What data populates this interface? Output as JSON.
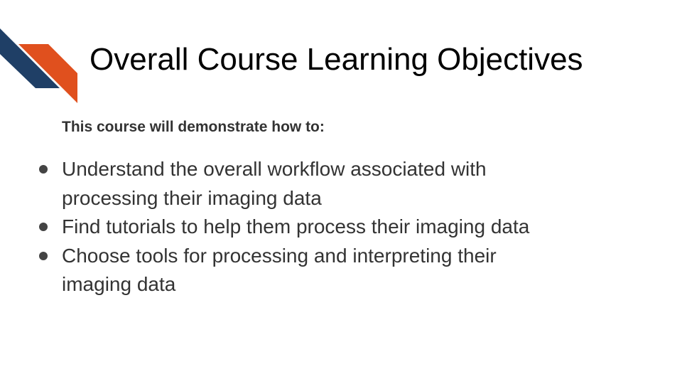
{
  "slide": {
    "title": "Overall Course Learning Objectives",
    "intro": "This course will demonstrate how to:",
    "objectives": [
      {
        "text_line1": "Understand the overall workflow associated with",
        "text_line2": "processing their imaging data"
      },
      {
        "text_line1": "Find tutorials to help them process their imaging data"
      },
      {
        "text_line1": "Choose tools for processing and interpreting their",
        "text_line2": "imaging data"
      }
    ]
  },
  "colors": {
    "accent_navy": "#1f3f66",
    "accent_orange": "#e0501e",
    "text_dark": "#333333",
    "title": "#000000"
  },
  "icons": {
    "corner_graphic": "diagonal-stripes-logo-icon",
    "bullet": "filled-circle-bullet-icon"
  }
}
